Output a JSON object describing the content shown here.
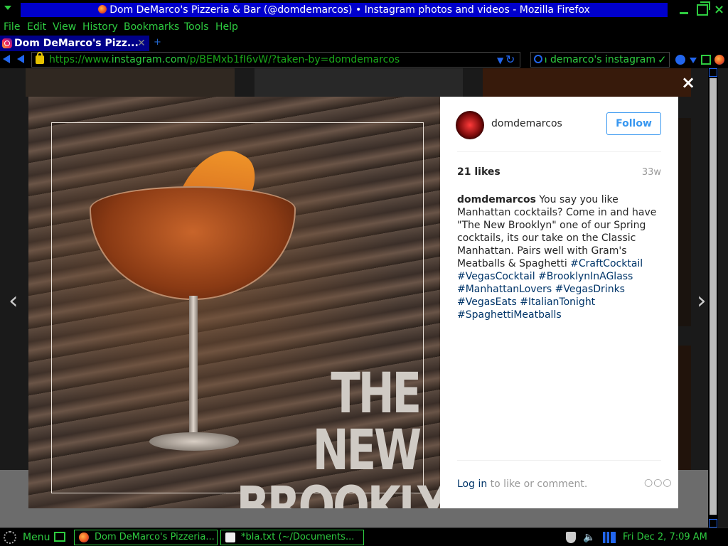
{
  "window": {
    "title": "Dom DeMarco's Pizzeria & Bar (@domdemarcos) • Instagram photos and videos - Mozilla Firefox"
  },
  "menu": [
    "File",
    "Edit",
    "View",
    "History",
    "Bookmarks",
    "Tools",
    "Help"
  ],
  "tab": {
    "label": "Dom DeMarco's Pizz...",
    "close": "✕",
    "new": "+"
  },
  "nav": {
    "url_prefix": "https://www.",
    "url_host": "instagram.com",
    "url_path": "/p/BEMxb1fI6vW/?taken-by=domdemarcos",
    "search_query": "dom demarco's instagram"
  },
  "modal": {
    "close": "×",
    "prev": "‹",
    "next": "›",
    "photo_text_line1": "THE NEW",
    "photo_text_line2": "BROOKLYN",
    "username": "domdemarcos",
    "follow_label": "Follow",
    "likes": "21 likes",
    "age": "33w",
    "caption_user": "domdemarcos",
    "caption_text": " You say you like Manhattan cocktails? Come in and have \"The New Brooklyn\" one of our Spring cocktails, its our take on the Classic Manhattan. Pairs well with Gram's Meatballs & Spaghetti ",
    "hashtags": [
      "#CraftCocktail",
      "#VegasCocktail",
      "#BrooklynInAGlass",
      "#ManhattanLovers",
      "#VegasDrinks",
      "#VegasEats",
      "#ItalianTonight",
      "#SpaghettiMeatballs"
    ],
    "login_link": "Log in",
    "login_rest": " to like or comment.",
    "more": "○○○"
  },
  "taskbar": {
    "menu_label": "Menu",
    "task1": "Dom DeMarco's Pizzeria...",
    "task2": "*bla.txt (~/Documents...",
    "clock": "Fri Dec  2,  7:09 AM"
  },
  "colors": {
    "accent_green": "#2ecc40",
    "title_blue": "#0000cc",
    "instagram_blue": "#3897f0",
    "hashtag_blue": "#003569"
  }
}
